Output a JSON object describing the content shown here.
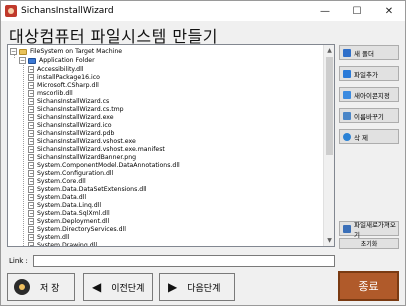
{
  "window": {
    "title": "SichansInstallWizard",
    "minimize_glyph": "—",
    "maximize_glyph": "☐",
    "close_glyph": "✕"
  },
  "heading": "대상컴퓨터 파일시스템 만들기",
  "tree": {
    "root": {
      "label": "FileSystem on Target Machine",
      "expander": "−",
      "icon": "folder-icon"
    },
    "app_folder": {
      "label": "Application Folder",
      "expander": "−",
      "icon": "blue-folder-icon"
    },
    "files": [
      "Accessibility.dll",
      "installPackage16.ico",
      "Microsoft.CSharp.dll",
      "mscorlib.dll",
      "SichansInstallWizard.cs",
      "SichansInstallWizard.cs.tmp",
      "SichansInstallWizard.exe",
      "SichansInstallWizard.ico",
      "SichansInstallWizard.pdb",
      "SichansInstallWizard.vshost.exe",
      "SichansInstallWizard.vshost.exe.manifest",
      "SichansInstallWizardBanner.png",
      "System.ComponentModel.DataAnnotations.dll",
      "System.Configuration.dll",
      "System.Core.dll",
      "System.Data.DataSetExtensions.dll",
      "System.Data.dll",
      "System.Data.Linq.dll",
      "System.Data.SqlXml.dll",
      "System.Deployment.dll",
      "System.DirectoryServices.dll",
      "System.dll",
      "System.Drawing.dll"
    ],
    "scroll_up_glyph": "▲",
    "scroll_down_glyph": "▼"
  },
  "side_buttons": {
    "new_folder": "새 폴더",
    "add_file": "파일추가",
    "change_icon": "새아이콘지정",
    "rename": "이름바꾸기",
    "delete": "삭 제",
    "import_files": "파일새로가져오기",
    "initialize": "초기화"
  },
  "link": {
    "label": "Link :",
    "value": ""
  },
  "bottom": {
    "save": "저 장",
    "prev": "이전단계",
    "prev_glyph": "◀",
    "next": "다음단계",
    "next_glyph": "▶",
    "exit": "종료"
  },
  "colors": {
    "exit_button": "#b05a2a",
    "accent": "#2a7ad8"
  }
}
